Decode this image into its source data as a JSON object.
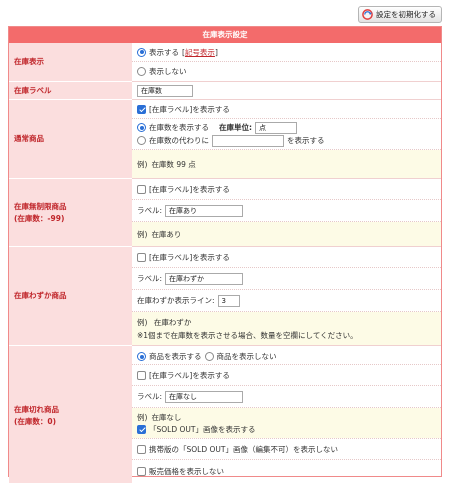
{
  "header": {
    "reset_button": "設定を初期化する"
  },
  "panel": {
    "title": "在庫表示設定"
  },
  "stock_display": {
    "label": "在庫表示",
    "option_show": "表示する",
    "legend_link_open": "[",
    "legend_link": "記号表示",
    "legend_link_close": "]",
    "option_hide": "表示しない"
  },
  "stock_label": {
    "label": "在庫ラベル",
    "value": "在庫数"
  },
  "normal": {
    "label": "通常商品",
    "show_label": "[在庫ラベル]を表示する",
    "show_count": "在庫数を表示する",
    "unit_label": "在庫単位:",
    "unit_value": "点",
    "instead_prefix": "在庫数の代わりに",
    "instead_suffix": "を表示する",
    "example": "例)",
    "example_text": "在庫数 99 点"
  },
  "unlimited": {
    "label_line1": "在庫無制限商品",
    "label_line2": "(在庫数：-99)",
    "show_label": "[在庫ラベル]を表示する",
    "label_caption": "ラベル:",
    "label_value": "在庫あり",
    "example": "例)",
    "example_text": "在庫あり"
  },
  "low": {
    "label": "在庫わずか商品",
    "show_label": "[在庫ラベル]を表示する",
    "label_caption": "ラベル:",
    "label_value": "在庫わずか",
    "line_caption": "在庫わずか表示ライン:",
    "line_value": "3",
    "example": "例)",
    "example_text": "在庫わずか",
    "note": "※1個まで在庫数を表示させる場合、数量を空欄にしてください。"
  },
  "soldout": {
    "label_line1": "在庫切れ商品",
    "label_line2": "(在庫数：0)",
    "option_show_product": "商品を表示する",
    "option_hide_product": "商品を表示しない",
    "show_label": "[在庫ラベル]を表示する",
    "label_caption": "ラベル:",
    "label_value": "在庫なし",
    "example": "例)",
    "example_text": "在庫なし",
    "show_soldout_image": "「SOLD OUT」画像を表示する",
    "mobile_soldout": "携帯版の「SOLD OUT」画像（編集不可）を表示しない",
    "hide_price": "販売価格を表示しない"
  },
  "colors": {
    "header_bg": "#f36b6b",
    "label_bg": "#fbdede",
    "label_text": "#c0262b",
    "example_bg": "#fdfbe6",
    "accent": "#2a6fd6"
  }
}
